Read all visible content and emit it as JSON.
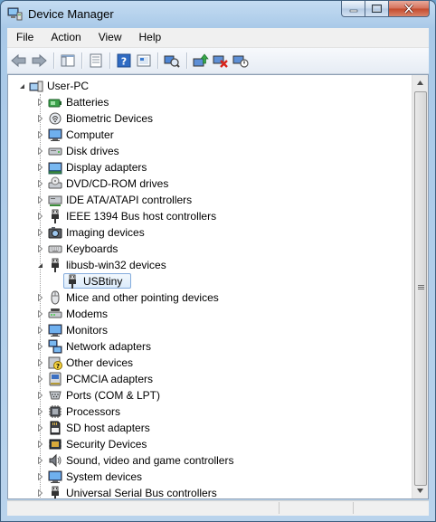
{
  "window": {
    "title": "Device Manager"
  },
  "menu": [
    {
      "id": "file",
      "label": "File"
    },
    {
      "id": "action",
      "label": "Action"
    },
    {
      "id": "view",
      "label": "View"
    },
    {
      "id": "help",
      "label": "Help"
    }
  ],
  "toolbar": [
    {
      "id": "back",
      "icon": "back-arrow-icon"
    },
    {
      "id": "forward",
      "icon": "forward-arrow-icon"
    },
    {
      "id": "show-hide-console-tree",
      "icon": "console-tree-icon"
    },
    {
      "id": "properties",
      "icon": "properties-icon"
    },
    {
      "id": "help",
      "icon": "help-icon"
    },
    {
      "id": "show-hidden",
      "icon": "show-hidden-devices-icon"
    },
    {
      "id": "update-driver",
      "icon": "update-driver-icon"
    },
    {
      "id": "uninstall",
      "icon": "uninstall-icon"
    },
    {
      "id": "scan-hardware",
      "icon": "scan-hardware-icon"
    }
  ],
  "tree": {
    "root": {
      "label": "User-PC",
      "expanded": true,
      "icon": "computer-icon"
    },
    "items": [
      {
        "label": "Batteries",
        "icon": "battery-icon",
        "expanded": false
      },
      {
        "label": "Biometric Devices",
        "icon": "fingerprint-icon",
        "expanded": false
      },
      {
        "label": "Computer",
        "icon": "monitor-icon",
        "expanded": false
      },
      {
        "label": "Disk drives",
        "icon": "disk-drive-icon",
        "expanded": false
      },
      {
        "label": "Display adapters",
        "icon": "display-adapter-icon",
        "expanded": false
      },
      {
        "label": "DVD/CD-ROM drives",
        "icon": "dvd-drive-icon",
        "expanded": false
      },
      {
        "label": "IDE ATA/ATAPI controllers",
        "icon": "ide-controller-icon",
        "expanded": false
      },
      {
        "label": "IEEE 1394 Bus host controllers",
        "icon": "usb-plug-icon",
        "expanded": false
      },
      {
        "label": "Imaging devices",
        "icon": "camera-icon",
        "expanded": false
      },
      {
        "label": "Keyboards",
        "icon": "keyboard-icon",
        "expanded": false
      },
      {
        "label": "libusb-win32 devices",
        "icon": "usb-plug-icon",
        "expanded": true,
        "children": [
          {
            "label": "USBtiny",
            "icon": "usb-plug-icon",
            "selected": true
          }
        ]
      },
      {
        "label": "Mice and other pointing devices",
        "icon": "mouse-icon",
        "expanded": false
      },
      {
        "label": "Modems",
        "icon": "modem-icon",
        "expanded": false
      },
      {
        "label": "Monitors",
        "icon": "monitor-icon",
        "expanded": false
      },
      {
        "label": "Network adapters",
        "icon": "network-icon",
        "expanded": false
      },
      {
        "label": "Other devices",
        "icon": "unknown-device-icon",
        "expanded": false
      },
      {
        "label": "PCMCIA adapters",
        "icon": "pcmcia-icon",
        "expanded": false
      },
      {
        "label": "Ports (COM & LPT)",
        "icon": "port-icon",
        "expanded": false
      },
      {
        "label": "Processors",
        "icon": "processor-icon",
        "expanded": false
      },
      {
        "label": "SD host adapters",
        "icon": "sd-card-icon",
        "expanded": false
      },
      {
        "label": "Security Devices",
        "icon": "security-chip-icon",
        "expanded": false
      },
      {
        "label": "Sound, video and game controllers",
        "icon": "speaker-icon",
        "expanded": false
      },
      {
        "label": "System devices",
        "icon": "monitor-icon",
        "expanded": false
      },
      {
        "label": "Universal Serial Bus controllers",
        "icon": "usb-plug-icon",
        "expanded": false
      }
    ]
  },
  "colors": {
    "selection_border": "#84acdd",
    "selection_fill": "#dcebfb"
  }
}
